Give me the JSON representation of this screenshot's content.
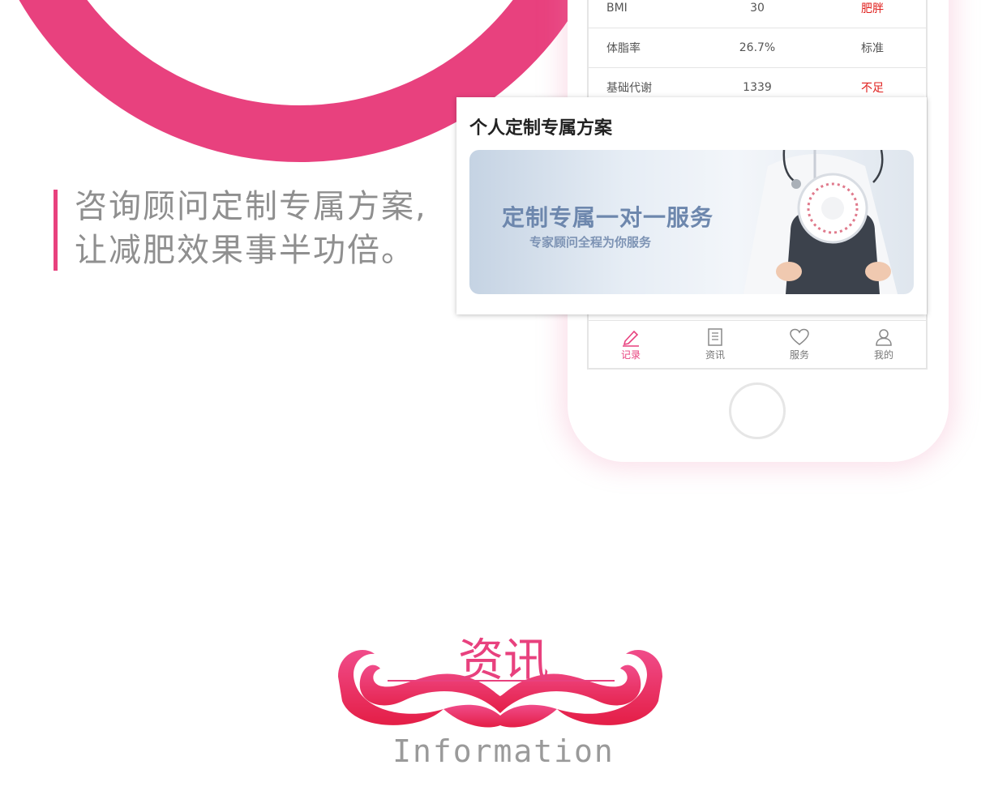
{
  "headline": {
    "line1": "咨询顾问定制专属方案,",
    "line2": "让减肥效果事半功倍。"
  },
  "metrics": [
    {
      "name": "BMI",
      "value": "30",
      "status": "肥胖",
      "status_alert": true
    },
    {
      "name": "体脂率",
      "value": "26.7%",
      "status": "标准",
      "status_alert": false
    },
    {
      "name": "基础代谢",
      "value": "1339",
      "status": "不足",
      "status_alert": true
    }
  ],
  "card": {
    "title": "个人定制专属方案",
    "banner_title": "定制专属一对一服务",
    "banner_subtitle": "专家顾问全程为你服务"
  },
  "tabs": [
    {
      "label": "记录",
      "icon": "pencil-icon",
      "active": true
    },
    {
      "label": "资讯",
      "icon": "document-icon",
      "active": false
    },
    {
      "label": "服务",
      "icon": "heart-icon",
      "active": false
    },
    {
      "label": "我的",
      "icon": "user-icon",
      "active": false
    }
  ],
  "section": {
    "title_zh": "资讯",
    "title_en": "Information"
  },
  "colors": {
    "accent": "#e8417e",
    "alert": "#e0201e",
    "text_gray": "#8f8f8f"
  }
}
